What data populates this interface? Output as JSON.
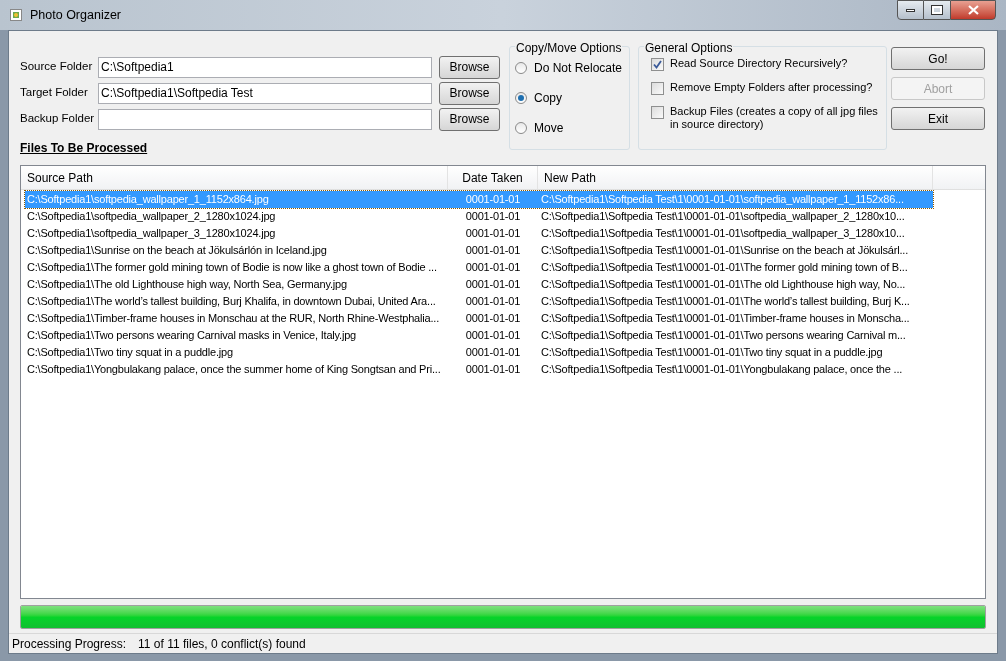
{
  "window": {
    "title": "Photo Organizer"
  },
  "folders": [
    {
      "label": "Source Folder",
      "value": "C:\\Softpedia1",
      "button": "Browse"
    },
    {
      "label": "Target Folder",
      "value": "C:\\Softpedia1\\Softpedia Test",
      "button": "Browse"
    },
    {
      "label": "Backup Folder",
      "button": "Browse"
    }
  ],
  "copy_move_options": {
    "title": "Copy/Move Options",
    "options": [
      {
        "label": "Do Not Relocate",
        "selected": false
      },
      {
        "label": "Copy",
        "selected": true
      },
      {
        "label": "Move",
        "selected": false
      }
    ]
  },
  "general_options": {
    "title": "General Options",
    "options": [
      {
        "label": "Read Source Directory Recursively?",
        "checked": true
      },
      {
        "label": "Remove Empty Folders after processing?",
        "checked": false
      },
      {
        "label": "Backup Files (creates a copy of all jpg files in source directory)",
        "checked": false
      }
    ]
  },
  "actions": [
    {
      "label": "Go!",
      "disabled": false
    },
    {
      "label": "Abort",
      "disabled": true
    },
    {
      "label": "Exit",
      "disabled": false
    }
  ],
  "files_heading": "Files To Be Processed",
  "table": {
    "columns": [
      "Source Path",
      "Date Taken",
      "New Path"
    ],
    "rows": [
      {
        "selected": true,
        "cells": [
          "C:\\Softpedia1\\softpedia_wallpaper_1_1152x864.jpg",
          "0001-01-01",
          "C:\\Softpedia1\\Softpedia Test\\1\\0001-01-01\\softpedia_wallpaper_1_1152x86..."
        ]
      },
      {
        "selected": false,
        "cells": [
          "C:\\Softpedia1\\softpedia_wallpaper_2_1280x1024.jpg",
          "0001-01-01",
          "C:\\Softpedia1\\Softpedia Test\\1\\0001-01-01\\softpedia_wallpaper_2_1280x10..."
        ]
      },
      {
        "selected": false,
        "cells": [
          "C:\\Softpedia1\\softpedia_wallpaper_3_1280x1024.jpg",
          "0001-01-01",
          "C:\\Softpedia1\\Softpedia Test\\1\\0001-01-01\\softpedia_wallpaper_3_1280x10..."
        ]
      },
      {
        "selected": false,
        "cells": [
          "C:\\Softpedia1\\Sunrise on the beach at Jökulsárlón in Iceland.jpg",
          "0001-01-01",
          "C:\\Softpedia1\\Softpedia Test\\1\\0001-01-01\\Sunrise on the beach at Jökulsárl..."
        ]
      },
      {
        "selected": false,
        "cells": [
          "C:\\Softpedia1\\The former gold mining town of Bodie is now like a ghost town of Bodie ...",
          "0001-01-01",
          "C:\\Softpedia1\\Softpedia Test\\1\\0001-01-01\\The former gold mining town of B..."
        ]
      },
      {
        "selected": false,
        "cells": [
          "C:\\Softpedia1\\The old Lighthouse high way, North Sea, Germany.jpg",
          "0001-01-01",
          "C:\\Softpedia1\\Softpedia Test\\1\\0001-01-01\\The old Lighthouse high way, No..."
        ]
      },
      {
        "selected": false,
        "cells": [
          "C:\\Softpedia1\\The world’s tallest building, Burj Khalifa, in downtown Dubai, United Ara...",
          "0001-01-01",
          "C:\\Softpedia1\\Softpedia Test\\1\\0001-01-01\\The world’s tallest building, Burj K..."
        ]
      },
      {
        "selected": false,
        "cells": [
          "C:\\Softpedia1\\Timber-frame houses in Monschau at the RUR, North Rhine-Westphalia...",
          "0001-01-01",
          "C:\\Softpedia1\\Softpedia Test\\1\\0001-01-01\\Timber-frame houses in Monscha..."
        ]
      },
      {
        "selected": false,
        "cells": [
          "C:\\Softpedia1\\Two persons wearing Carnival masks in Venice, Italy.jpg",
          "0001-01-01",
          "C:\\Softpedia1\\Softpedia Test\\1\\0001-01-01\\Two persons wearing Carnival m..."
        ]
      },
      {
        "selected": false,
        "cells": [
          "C:\\Softpedia1\\Two tiny squat in a puddle.jpg",
          "0001-01-01",
          "C:\\Softpedia1\\Softpedia Test\\1\\0001-01-01\\Two tiny squat in a puddle.jpg"
        ]
      },
      {
        "selected": false,
        "cells": [
          "C:\\Softpedia1\\Yongbulakang palace, once the summer home of King Songtsan and Pri...",
          "0001-01-01",
          "C:\\Softpedia1\\Softpedia Test\\1\\0001-01-01\\Yongbulakang palace, once the ..."
        ]
      }
    ]
  },
  "progress": {
    "level": 1
  },
  "status_bar": {
    "label": "Processing Progress:",
    "value": "11 of 11 files, 0 conflict(s) found"
  }
}
